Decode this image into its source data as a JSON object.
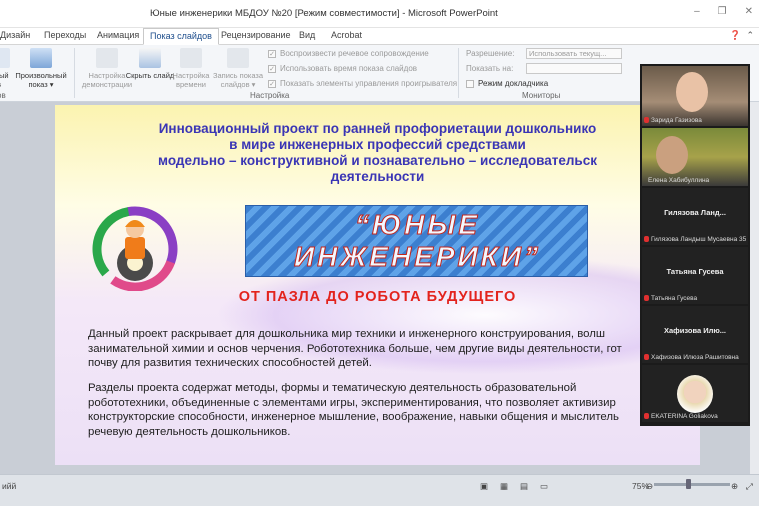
{
  "window": {
    "title": "Юные инженерики МБДОУ №20 [Режим совместимости]  -  Microsoft PowerPoint",
    "controls": [
      "–",
      "❐",
      "✕"
    ]
  },
  "ribbon_tabs": [
    "Дизайн",
    "Переходы",
    "Анимация",
    "Показ слайдов",
    "Рецензирование",
    "Вид",
    "Acrobat"
  ],
  "active_tab": "Показ слайдов",
  "ribbon": {
    "buttons": [
      {
        "label": "Произвольный показ ▾",
        "enabled": true
      },
      {
        "label": "Настройка демонстрации",
        "enabled": false
      },
      {
        "label": "Скрыть слайд",
        "enabled": true
      },
      {
        "label": "Настройка времени",
        "enabled": false
      },
      {
        "label": "Запись показа слайдов ▾",
        "enabled": false
      }
    ],
    "left_cut": [
      "ыный",
      "в",
      "ов"
    ],
    "checkboxes": [
      {
        "label": "Воспроизвести речевое сопровождение",
        "checked": true
      },
      {
        "label": "Использовать время показа слайдов",
        "checked": true
      },
      {
        "label": "Показать элементы управления проигрывателя",
        "checked": true
      },
      {
        "label": "Режим докладчика",
        "checked": false
      }
    ],
    "resolution_label": "Разрешение:",
    "resolution_value": "Использовать текущ...",
    "show_on_label": "Показать на:",
    "group_settings": "Настройка",
    "group_monitors": "Мониторы"
  },
  "slide": {
    "headline": [
      "Инновационный проект по ранней профориетации дошкольнико",
      "в мире инженерных профессий средствами",
      "модельно – конструктивной и познавательно – исследовательск",
      "деятельности"
    ],
    "banner": [
      "“ЮНЫЕ",
      "ИНЖЕНЕРИКИ”"
    ],
    "subtitle": "ОТ  ПАЗЛА  ДО  РОБОТА  БУДУЩЕГО",
    "paragraph1": [
      "   Данный проект раскрывает для  дошкольника мир техники и инженерного конструирования, волш",
      "занимательной химии и основ черчения. Робототехника больше, чем другие виды деятельности, гот",
      "почву для развития технических  способностей детей."
    ],
    "paragraph2": [
      "Разделы проекта содержат методы, формы  и  тематическую деятельность образовательной",
      "робототехники, объединенные  с элементами игры, экспериментирования, что позволяет активизир",
      "конструкторские способности, инженерное мышление, воображение, навыки общения  и мыслитель",
      "речевую деятельность дошкольников."
    ]
  },
  "participants": [
    {
      "name": "Зарида Газизова",
      "type": "video"
    },
    {
      "name": "Елена Хабибуллина",
      "type": "video"
    },
    {
      "title": "Гилязова  Ланд...",
      "name": "Гилязова Ландыш Мусаевна 35",
      "type": "name"
    },
    {
      "title": "Татьяна Гусева",
      "name": "Татьяна Гусева",
      "type": "name"
    },
    {
      "title": "Хафизова  Илю...",
      "name": "Хафизова Илюза Рашитовна",
      "type": "name"
    },
    {
      "name": "EKATERINA Goliakova",
      "type": "photo"
    }
  ],
  "status": {
    "left": "ийй",
    "zoom": "75%",
    "minus": "⊖",
    "plus": "⊕"
  },
  "colors": {
    "headline": "#3a35b5",
    "subtitle": "#e3231d",
    "banner": "#3c7fcf",
    "banner_text_outline": "#c4261c"
  }
}
